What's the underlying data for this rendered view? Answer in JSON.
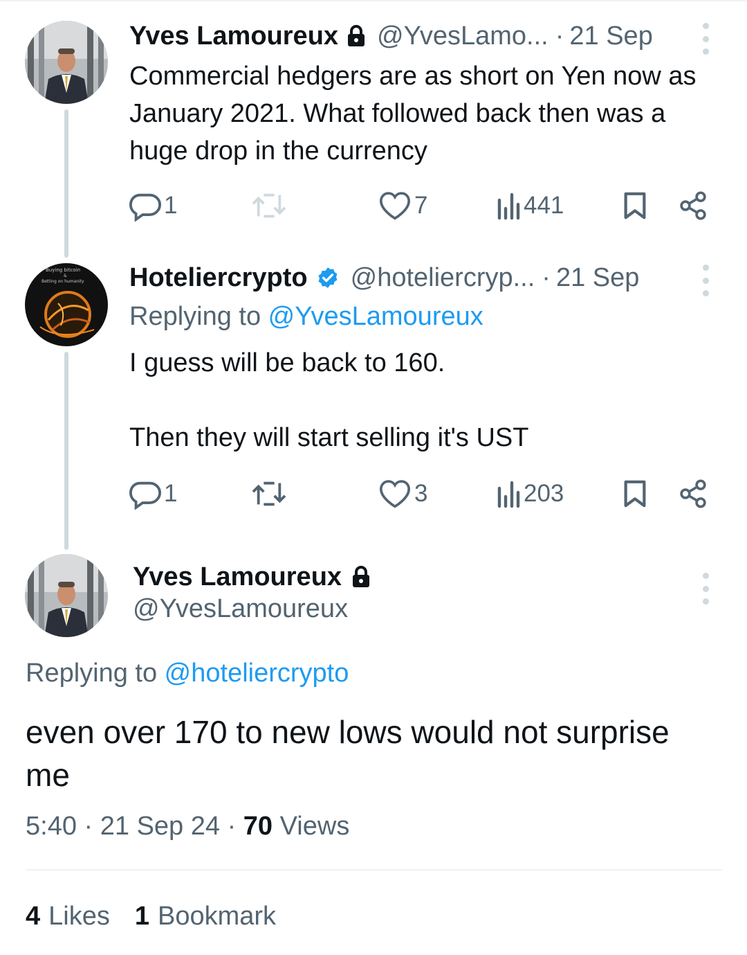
{
  "tweets": [
    {
      "name": "Yves Lamoureux",
      "handle": "@YvesLamo...",
      "separator": "·",
      "date": "21 Sep",
      "text": "Commercial hedgers are as short on Yen now as January 2021. What followed back then was a huge drop in the currency",
      "replies": "1",
      "retweets": "",
      "likes": "7",
      "views": "441"
    },
    {
      "name": "Hoteliercrypto",
      "handle": "@hoteliercryp...",
      "separator": "·",
      "date": "21 Sep",
      "replying_prefix": "Replying to ",
      "replying_mention": "@YvesLamoureux",
      "text_line1": "I guess will be back to 160.",
      "text_line2": "Then they will start selling it's UST",
      "replies": "1",
      "retweets": "",
      "likes": "3",
      "views": "203",
      "avatar_text_1": "Buying bitcoin",
      "avatar_text_2": "&",
      "avatar_text_3": "Betting on humanity"
    }
  ],
  "main_tweet": {
    "name": "Yves Lamoureux",
    "handle": "@YvesLamoureux",
    "replying_prefix": "Replying to ",
    "replying_mention": "@hoteliercrypto",
    "text": "even over 170  to new lows would not surprise me",
    "time": "5:40",
    "separator": "·",
    "date": "21 Sep 24",
    "views_count": "70",
    "views_label": "Views",
    "likes_count": "4",
    "likes_label": "Likes",
    "bookmarks_count": "1",
    "bookmarks_label": "Bookmark"
  },
  "colors": {
    "text_primary": "#0f1419",
    "text_secondary": "#536471",
    "accent": "#1d9bf0",
    "thread_line": "#cfd9de",
    "divider": "#eff3f4"
  },
  "icons": [
    "lock-icon",
    "verified-badge-icon",
    "more-icon",
    "reply-icon",
    "retweet-icon",
    "like-icon",
    "views-icon",
    "bookmark-icon",
    "share-icon"
  ]
}
